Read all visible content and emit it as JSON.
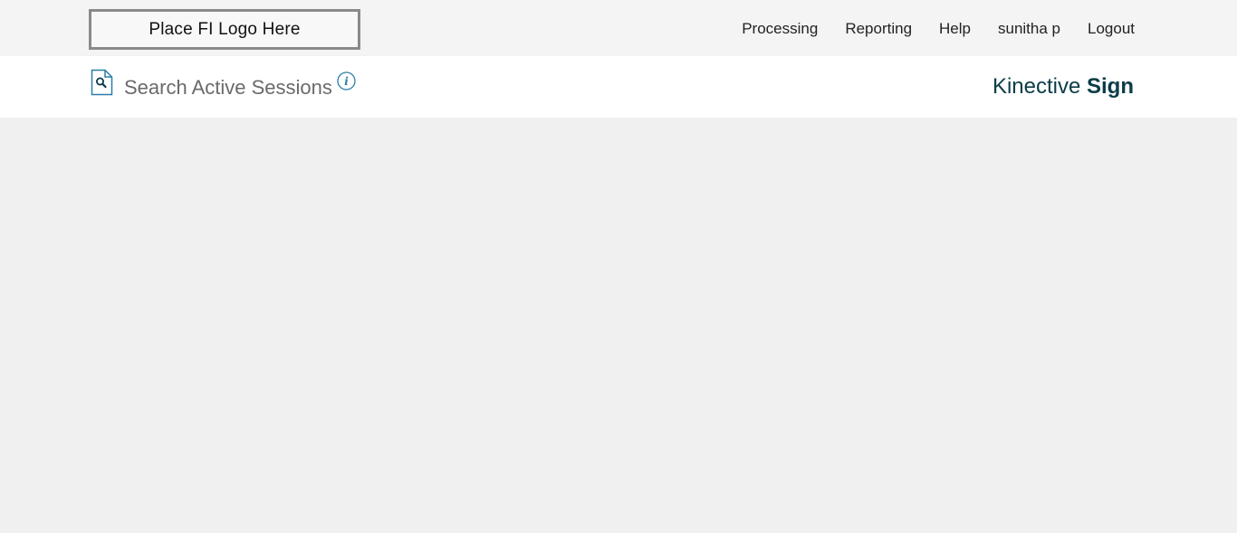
{
  "header": {
    "logo_text": "Place FI Logo Here",
    "nav": [
      {
        "label": "Processing"
      },
      {
        "label": "Reporting"
      },
      {
        "label": "Help"
      },
      {
        "label": "sunitha p"
      },
      {
        "label": "Logout"
      }
    ]
  },
  "subheader": {
    "page_icon": "document-search-icon",
    "title": "Search Active Sessions",
    "info_icon": "info-icon",
    "brand_prefix": "Kinective",
    "brand_suffix": "Sign"
  },
  "colors": {
    "brand": "#0b3c48",
    "icon_accent": "#2b7fa8",
    "topbar_bg": "#f4f4f4",
    "content_bg": "#f0f0f0"
  }
}
